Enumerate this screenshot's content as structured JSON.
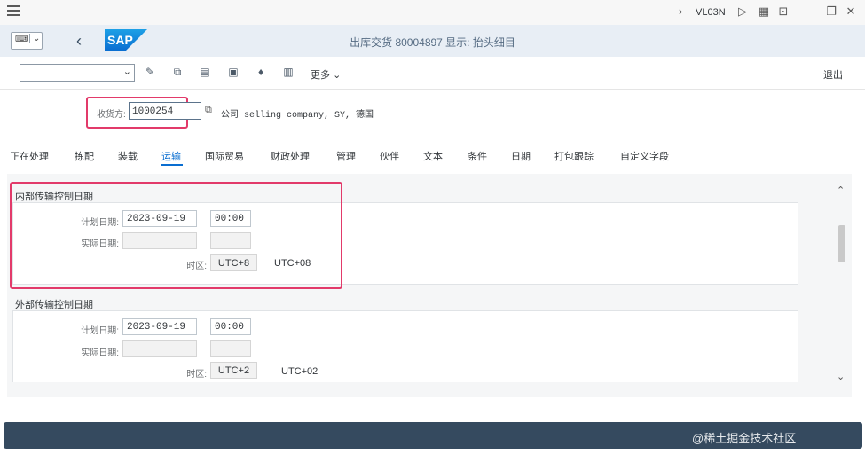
{
  "system": {
    "tcode": "VL03N"
  },
  "header": {
    "title": "出库交货 80004897 显示: 抬头细目",
    "logo_text": "SAP"
  },
  "toolbar": {
    "more_label": "更多",
    "exit_label": "退出"
  },
  "partner": {
    "label": "收货方:",
    "value": "1000254",
    "description": "公司 selling company, SY, 德国"
  },
  "tabs": [
    "正在处理",
    "拣配",
    "装载",
    "运输",
    "国际贸易",
    "财政处理",
    "管理",
    "伙伴",
    "文本",
    "条件",
    "日期",
    "打包跟踪",
    "自定义字段"
  ],
  "active_tab_index": 3,
  "inner": {
    "title": "内部传输控制日期",
    "planned_label": "计划日期:",
    "planned_date": "2023-09-19",
    "planned_time": "00:00",
    "actual_label": "实际日期:",
    "tz_label": "时区:",
    "tz_code": "UTC+8",
    "tz_name": "UTC+08"
  },
  "outer": {
    "title": "外部传输控制日期",
    "planned_label": "计划日期:",
    "planned_date": "2023-09-19",
    "planned_time": "00:00",
    "actual_label": "实际日期:",
    "tz_label": "时区:",
    "tz_code": "UTC+2",
    "tz_name": "UTC+02"
  },
  "watermark": "@稀土掘金技术社区",
  "colors": {
    "accent": "#0a6ed1",
    "highlight": "#e23a6a",
    "footer": "#354a5f",
    "header": "#e8eef5"
  }
}
